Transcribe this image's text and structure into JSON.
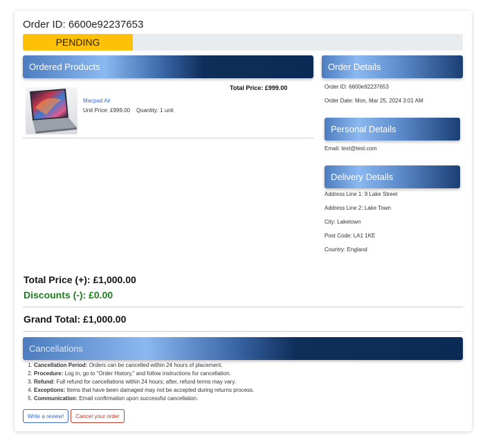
{
  "order": {
    "id_label": "Order ID: 6600e92237653",
    "status": "PENDING",
    "status_progress": 0.25
  },
  "ordered_products": {
    "title": "Ordered Products",
    "total_price_label": "Total Price: £999.00",
    "items": [
      {
        "name": "Macpad Air",
        "unit_price": "Unit Price: £999.00",
        "quantity": "Quantity: 1 unit"
      }
    ]
  },
  "order_details": {
    "title": "Order Details",
    "order_id": "Order ID: 6600e92237653",
    "order_date": "Order Date: Mon, Mar 25, 2024 3:01 AM"
  },
  "personal_details": {
    "title": "Personal Details",
    "email": "Email: test@test.com"
  },
  "delivery_details": {
    "title": "Delivery Details",
    "address1": "Address Line 1: 9 Lake Street",
    "address2": "Address Line 2: Lake Town",
    "city": "City: Laketown",
    "post_code": "Post Code: LA1 1KE",
    "country": "Country: England"
  },
  "totals": {
    "total_price": "Total Price (+): £1,000.00",
    "discounts": "Discounts (-): £0.00",
    "grand_total": "Grand Total: £1,000.00",
    "discount_color": "#1e7e1e"
  },
  "cancellations": {
    "title": "Cancellations",
    "items": [
      {
        "bold": "Cancellation Period:",
        "text": " Orders can be cancelled within 24 hours of placement."
      },
      {
        "bold": "Procedure:",
        "text": " Log in, go to \"Order History,\" and follow instructions for cancellation."
      },
      {
        "bold": "Refund:",
        "text": " Full refund for cancellations within 24 hours; after, refund terms may vary."
      },
      {
        "bold": "Exceptions:",
        "text": " Items that have been damaged may not be accepted during returns process."
      },
      {
        "bold": "Communication:",
        "text": " Email confirmation upon successful cancellation."
      }
    ]
  },
  "actions": {
    "review_label": "Write a review!",
    "cancel_label": "Cancel your order"
  },
  "colors": {
    "status_yellow": "#ffc107",
    "header_navy": "#0b2a55",
    "link_blue": "#3867d6",
    "danger_red": "#c0392b"
  }
}
